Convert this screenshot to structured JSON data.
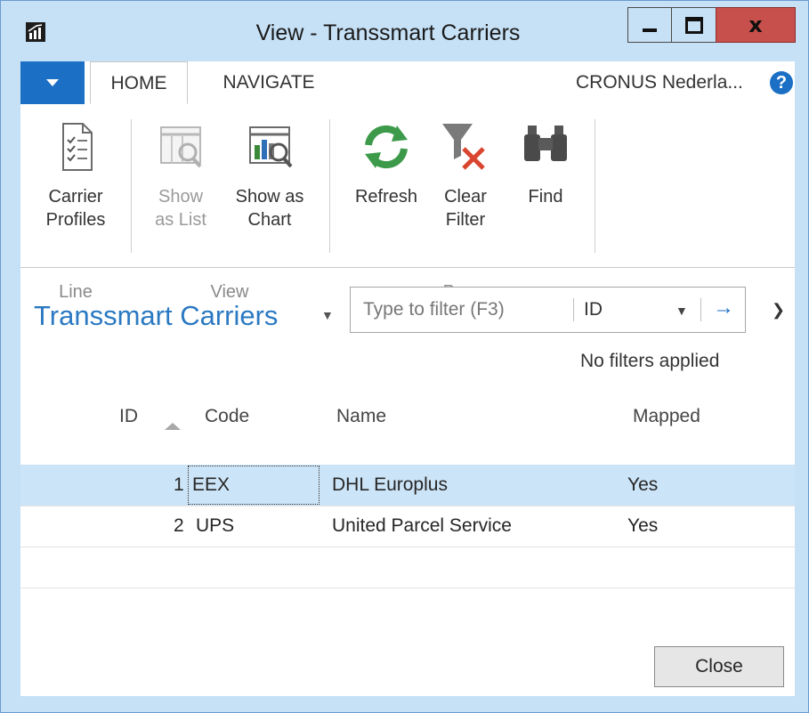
{
  "window": {
    "title": "View - Transsmart Carriers",
    "min_glyph": "minimize-icon",
    "max_glyph": "maximize-icon",
    "close_glyph": "x"
  },
  "tabs": {
    "home": "HOME",
    "navigate": "NAVIGATE",
    "company": "CRONUS Nederla...",
    "help": "?"
  },
  "ribbon": {
    "groups": {
      "line": "Line",
      "view": "View",
      "page": "Page"
    },
    "buttons": {
      "carrier_profiles": [
        "Carrier",
        "Profiles"
      ],
      "show_as_list": [
        "Show",
        "as List"
      ],
      "show_as_chart": [
        "Show as",
        "Chart"
      ],
      "refresh": "Refresh",
      "clear_filter": [
        "Clear",
        "Filter"
      ],
      "find": "Find"
    }
  },
  "list": {
    "title": "Transsmart Carriers",
    "filter_placeholder": "Type to filter (F3)",
    "filter_field": "ID",
    "filter_status": "No filters applied",
    "columns": {
      "id": "ID",
      "code": "Code",
      "name": "Name",
      "mapped": "Mapped"
    },
    "rows": [
      {
        "id": "1",
        "code": "EEX",
        "name": "DHL Europlus",
        "mapped": "Yes"
      },
      {
        "id": "2",
        "code": "UPS",
        "name": "United Parcel Service",
        "mapped": "Yes"
      }
    ]
  },
  "footer": {
    "close_label": "Close"
  },
  "colors": {
    "titlebar": "#c6e0f5",
    "accent": "#1b6fc4",
    "close_red": "#c7504c",
    "selected_row": "#cce4f7",
    "list_title": "#2b79c2"
  }
}
